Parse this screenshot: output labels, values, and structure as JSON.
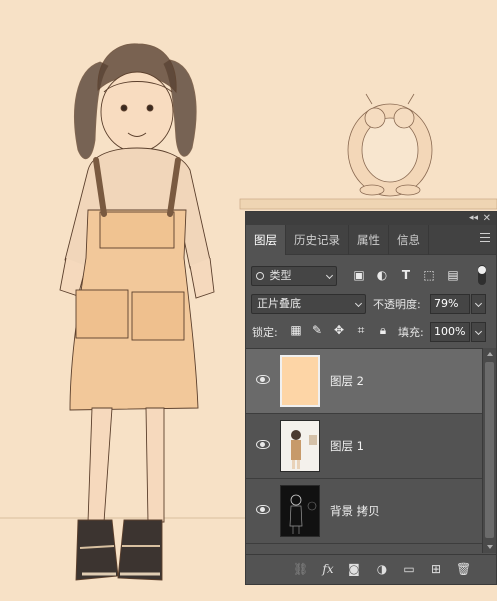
{
  "panel": {
    "tabs": [
      {
        "label": "图层",
        "active": true
      },
      {
        "label": "历史记录",
        "active": false
      },
      {
        "label": "属性",
        "active": false
      },
      {
        "label": "信息",
        "active": false
      }
    ],
    "filter": {
      "kind_label": "类型"
    },
    "blend_mode": "正片叠底",
    "opacity_label": "不透明度:",
    "opacity_value": "79%",
    "lock_label": "锁定:",
    "fill_label": "填充:",
    "fill_value": "100%",
    "layers": [
      {
        "name": "图层 2",
        "selected": true,
        "visible": true,
        "thumb": "peach-fill"
      },
      {
        "name": "图层 1",
        "selected": false,
        "visible": true,
        "thumb": "photo"
      },
      {
        "name": "背景 拷贝",
        "selected": false,
        "visible": true,
        "thumb": "dark-sketch"
      }
    ],
    "bottom_fx_label": "fx"
  },
  "colors": {
    "canvas_bg": "#f6dfc2",
    "layer2_fill": "#fdd5a6",
    "panel_bg": "#535353"
  }
}
